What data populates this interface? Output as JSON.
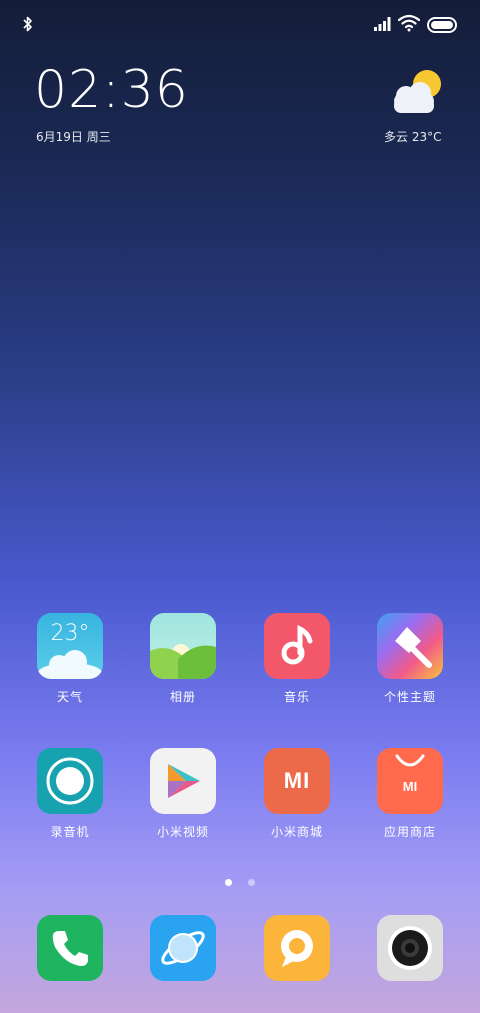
{
  "status": {
    "bluetooth_icon": "bluetooth-icon",
    "signal_icon": "cell-signal-icon",
    "wifi_icon": "wifi-icon",
    "battery_icon": "battery-icon"
  },
  "clock_widget": {
    "time": "02:36",
    "date": "6月19日  周三"
  },
  "weather_widget": {
    "icon": "partly-cloudy-icon",
    "text": "多云  23°C"
  },
  "apps": [
    {
      "label": "天气",
      "icon": "weather-icon",
      "tile_text": "23°"
    },
    {
      "label": "相册",
      "icon": "gallery-icon"
    },
    {
      "label": "音乐",
      "icon": "music-icon"
    },
    {
      "label": "个性主题",
      "icon": "themes-icon"
    },
    {
      "label": "录音机",
      "icon": "recorder-icon"
    },
    {
      "label": "小米视频",
      "icon": "video-icon"
    },
    {
      "label": "小米商城",
      "icon": "mi-store-icon",
      "tile_text": "MI"
    },
    {
      "label": "应用商店",
      "icon": "app-store-icon",
      "tile_text": "MI"
    }
  ],
  "page_indicator": {
    "pages": 2,
    "current": 1
  },
  "dock": [
    {
      "icon": "phone-icon",
      "color": "#1fb45f"
    },
    {
      "icon": "browser-icon",
      "color": "#2aa4f0"
    },
    {
      "icon": "messages-icon",
      "color": "#fbb53a"
    },
    {
      "icon": "camera-icon",
      "color": "#dedede"
    }
  ],
  "colors": {
    "weather_tile": "#3fbde0",
    "music_tile": "#f2586a",
    "recorder_tile": "#17a2b0",
    "mi_store_tile": "#ec6a4a",
    "app_store_tile": "#ff6a4d"
  }
}
